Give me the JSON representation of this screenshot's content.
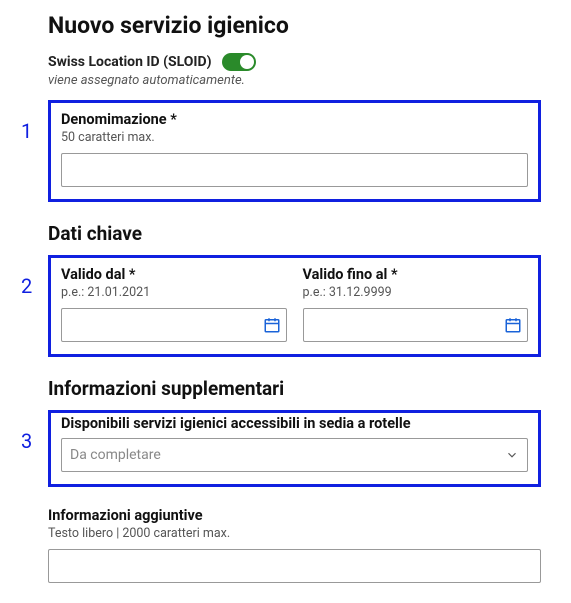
{
  "page_title": "Nuovo servizio igienico",
  "sloid": {
    "label": "Swiss Location ID (SLOID)",
    "auto_hint": "viene assegnato automaticamente.",
    "enabled": true
  },
  "markers": {
    "m1": "1",
    "m2": "2",
    "m3": "3"
  },
  "name_field": {
    "label": "Denomimazione *",
    "hint": "50 caratteri max.",
    "value": ""
  },
  "sections": {
    "key_data": "Dati chiave",
    "supplementary": "Informazioni supplementari"
  },
  "valid_from": {
    "label": "Valido dal *",
    "hint": "p.e.: 21.01.2021",
    "value": ""
  },
  "valid_to": {
    "label": "Valido fino al *",
    "hint": "p.e.: 31.12.9999",
    "value": ""
  },
  "wheelchair": {
    "label": "Disponibili servizi igienici accessibili in sedia a rotelle",
    "selected": "Da completare"
  },
  "additional_info": {
    "label": "Informazioni aggiuntive",
    "hint": "Testo libero | 2000 caratteri max.",
    "value": ""
  }
}
